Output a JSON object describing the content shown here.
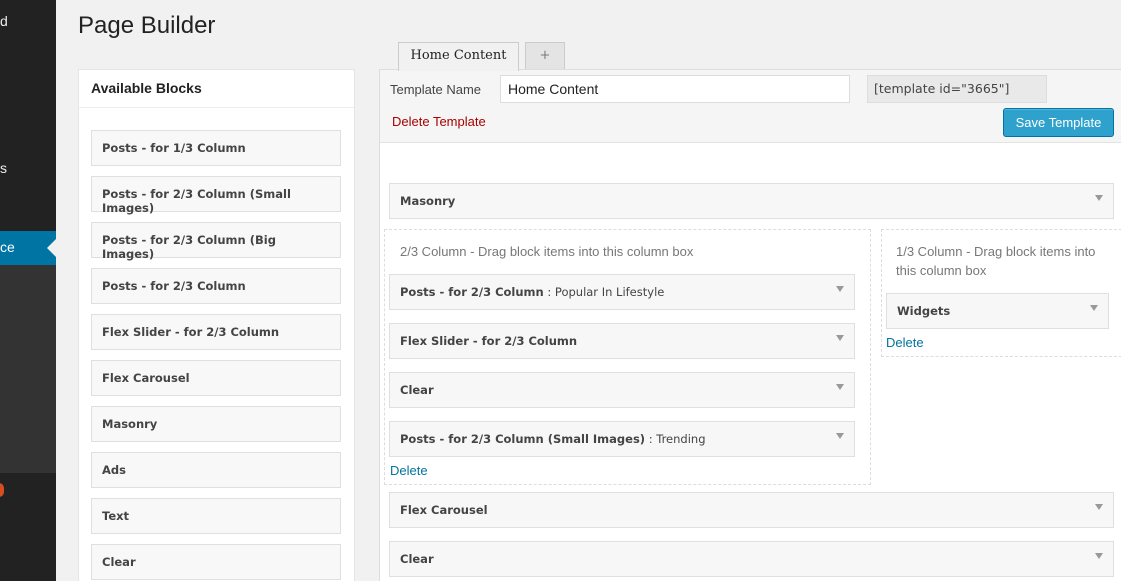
{
  "sidebar": {
    "fragments": [
      "d",
      "s",
      "ce"
    ]
  },
  "page_title": "Page Builder",
  "available_blocks": {
    "heading": "Available Blocks",
    "items": [
      "Posts - for 1/3 Column",
      "Posts - for 2/3 Column (Small Images)",
      "Posts - for 2/3 Column (Big Images)",
      "Posts - for 2/3 Column",
      "Flex Slider - for 2/3 Column",
      "Flex Carousel",
      "Masonry",
      "Ads",
      "Text",
      "Clear"
    ]
  },
  "tabs": {
    "active": "Home Content",
    "add": "+"
  },
  "template": {
    "name_label": "Template Name",
    "name_value": "Home Content",
    "shortcode": "[template id=\"3665\"]",
    "delete_label": "Delete Template",
    "save_label": "Save Template"
  },
  "layout": {
    "masonry": "Masonry",
    "col_two_thirds": {
      "description": "2/3 Column - Drag block items into this column box",
      "items": [
        {
          "title": "Posts - for 2/3 Column",
          "subtitle": " : Popular In Lifestyle"
        },
        {
          "title": "Flex Slider - for 2/3 Column",
          "subtitle": ""
        },
        {
          "title": "Clear",
          "subtitle": ""
        },
        {
          "title": "Posts - for 2/3 Column (Small Images)",
          "subtitle": " : Trending"
        }
      ],
      "delete_label": "Delete"
    },
    "col_one_third": {
      "description": "1/3 Column - Drag block items into this column box",
      "items": [
        {
          "title": "Widgets",
          "subtitle": ""
        }
      ],
      "delete_label": "Delete"
    },
    "flex_carousel": "Flex Carousel",
    "clear": "Clear"
  },
  "colors": {
    "accent": "#0074a2",
    "button": "#2ea2cc",
    "danger": "#aa0000"
  }
}
